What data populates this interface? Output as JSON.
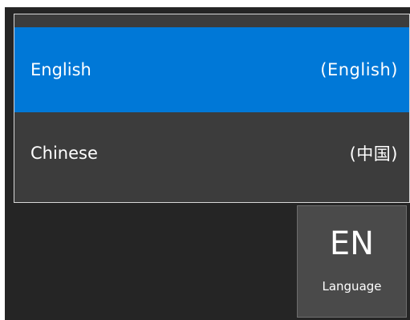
{
  "language_menu": {
    "options": [
      {
        "name": "English",
        "native": "(English)",
        "selected": true
      },
      {
        "name": "Chinese",
        "native": "(中国)",
        "selected": false
      }
    ]
  },
  "language_tile": {
    "code": "EN",
    "caption": "Language"
  },
  "colors": {
    "selected_background": "#0078d7",
    "menu_background": "#3c3c3c",
    "tile_background": "#4a4a4a",
    "app_background": "#252525",
    "text": "#ffffff"
  }
}
